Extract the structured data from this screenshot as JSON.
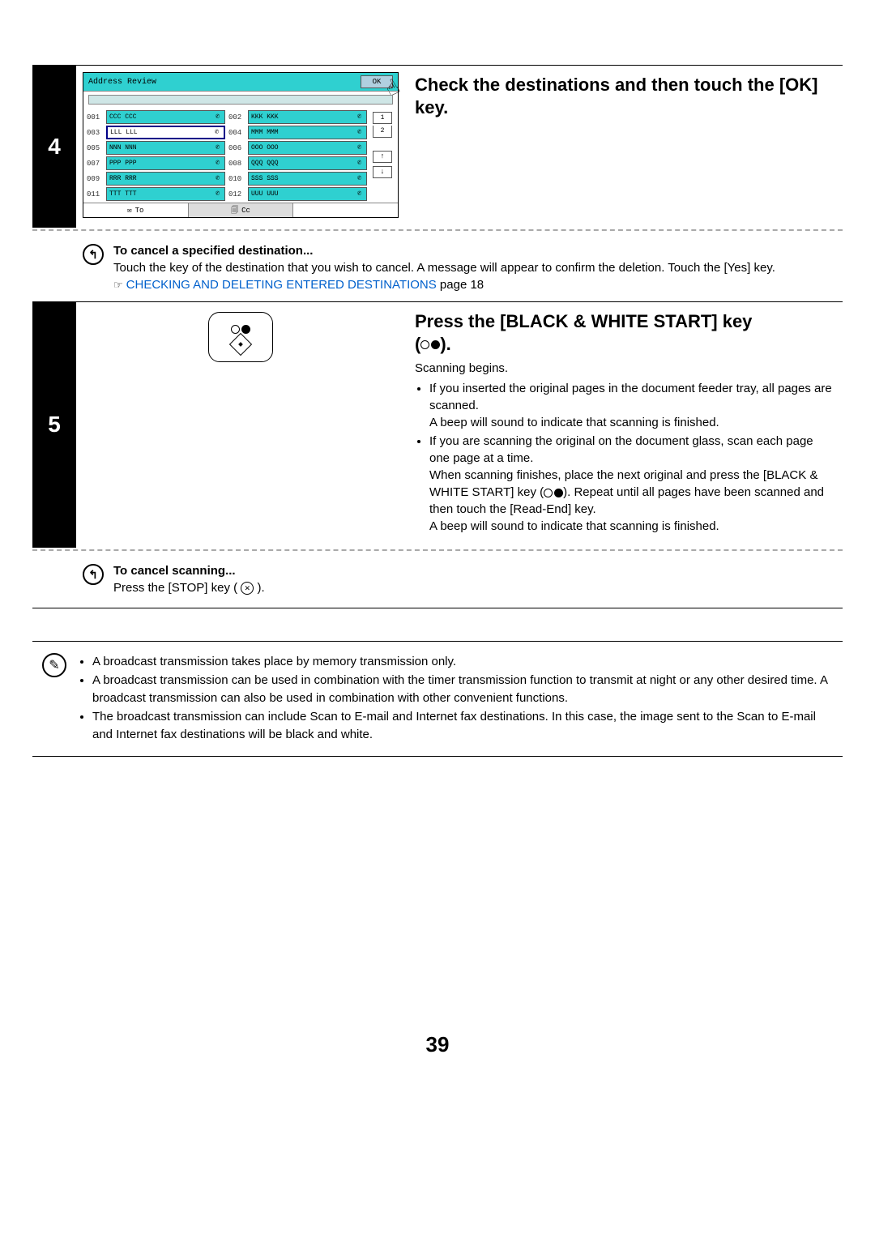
{
  "page_number": "39",
  "step4": {
    "number": "4",
    "heading": "Check the destinations and then touch the [OK] key.",
    "panel": {
      "title": "Address Review",
      "ok": "OK",
      "page_current": "1",
      "page_total": "2",
      "arrow_up": "↑",
      "arrow_down": "↓",
      "tabs": {
        "to_icon": "✉",
        "to": "To",
        "cc_icon": "🗐",
        "cc": "Cc"
      },
      "rows": [
        {
          "n": "001",
          "label": "CCC CCC",
          "sel": false
        },
        {
          "n": "002",
          "label": "KKK KKK",
          "sel": false
        },
        {
          "n": "003",
          "label": "LLL LLL",
          "sel": true
        },
        {
          "n": "004",
          "label": "MMM MMM",
          "sel": false
        },
        {
          "n": "005",
          "label": "NNN NNN",
          "sel": false
        },
        {
          "n": "006",
          "label": "OOO OOO",
          "sel": false
        },
        {
          "n": "007",
          "label": "PPP PPP",
          "sel": false
        },
        {
          "n": "008",
          "label": "QQQ QQQ",
          "sel": false
        },
        {
          "n": "009",
          "label": "RRR RRR",
          "sel": false
        },
        {
          "n": "010",
          "label": "SSS SSS",
          "sel": false
        },
        {
          "n": "011",
          "label": "TTT TTT",
          "sel": false
        },
        {
          "n": "012",
          "label": "UUU UUU",
          "sel": false
        }
      ]
    },
    "note": {
      "title": "To cancel a specified destination...",
      "body": "Touch the key of the destination that you wish to cancel. A message will appear to confirm the deletion. Touch the [Yes] key.",
      "ref_icon": "☞",
      "ref_link": "CHECKING AND DELETING ENTERED DESTINATIONS",
      "ref_tail": " page 18"
    }
  },
  "step5": {
    "number": "5",
    "heading_a": "Press the [BLACK & WHITE START] key",
    "heading_b": "(",
    "heading_c": ").",
    "begin": "Scanning begins.",
    "b1": "If you inserted the original pages in the document feeder tray, all pages are scanned.",
    "b1_tail": "A beep will sound to indicate that scanning is finished.",
    "b2": "If you are scanning the original on the document glass, scan each page one page at a time.",
    "b2_p1": "When scanning finishes, place the next original and press the [BLACK & WHITE START] key (",
    "b2_p1_tail": "). Repeat until all pages have been scanned and then touch the [Read-End] key.",
    "b2_p2": "A beep will sound to indicate that scanning is finished.",
    "note": {
      "title": "To cancel scanning...",
      "body_a": "Press the [STOP] key ( ",
      "body_b": " )."
    }
  },
  "info": {
    "i1": "A broadcast transmission takes place by memory transmission only.",
    "i2": "A broadcast transmission can be used in combination with the timer transmission function to transmit at night or any other desired time. A broadcast transmission can also be used in combination with other convenient functions.",
    "i3": "The broadcast transmission can include Scan to E-mail and Internet fax destinations. In this case, the image sent to the Scan to E-mail and Internet fax destinations will be black and white."
  }
}
